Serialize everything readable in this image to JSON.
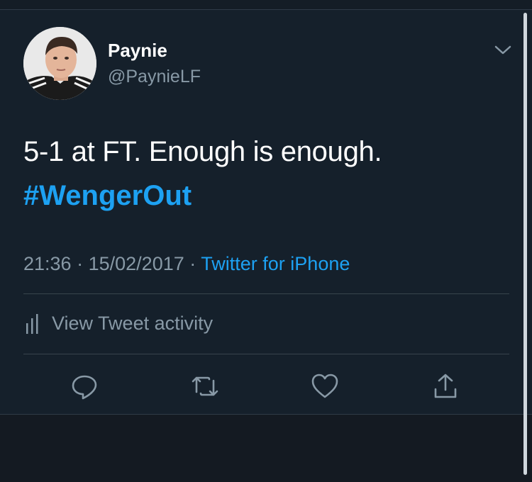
{
  "tweet": {
    "author": {
      "display_name": "Paynie",
      "handle": "@PaynieLF"
    },
    "text": "5-1 at FT. Enough is enough.",
    "hashtag": "#WengerOut",
    "time": "21:36",
    "date": "15/02/2017",
    "separator": "·",
    "source": "Twitter for iPhone"
  },
  "activity": {
    "label": "View Tweet activity"
  },
  "actions": [
    {
      "icon": "reply-icon"
    },
    {
      "icon": "retweet-icon"
    },
    {
      "icon": "like-icon"
    },
    {
      "icon": "share-icon"
    }
  ],
  "colors": {
    "background": "#15202b",
    "text": "#ffffff",
    "secondary": "#8899a6",
    "accent": "#1da1f2",
    "divider": "#38444d"
  }
}
